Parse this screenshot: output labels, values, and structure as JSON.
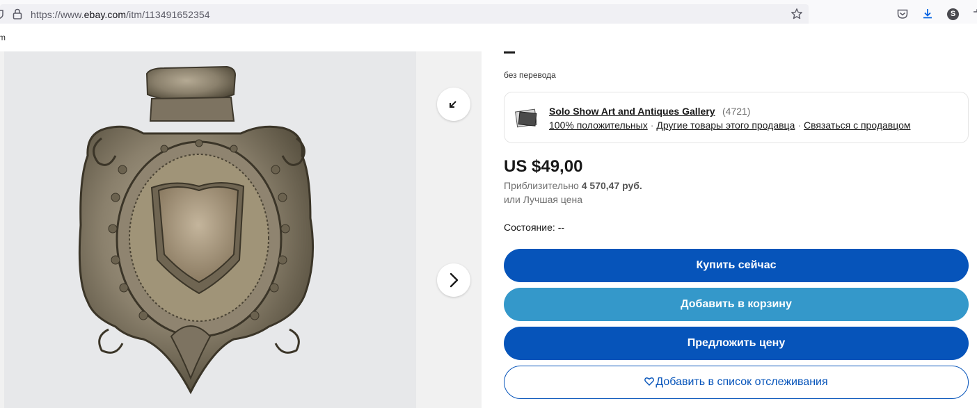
{
  "browser": {
    "url_prefix": "https://www.",
    "url_host": "ebay.com",
    "url_path": "/itm/113491652354",
    "account_initial": "S"
  },
  "subbar": {
    "text": "m"
  },
  "listing": {
    "translation_note": "без перевода",
    "seller": {
      "name": "Solo Show Art and Antiques Gallery",
      "feedback_count": "(4721)",
      "positive": "100% положительных",
      "other_items": "Другие товары этого продавца",
      "contact": "Связаться с продавцом",
      "separator": "·"
    },
    "price": "US $49,00",
    "approx_label": "Приблизительно",
    "approx_value": "4 570,47 руб.",
    "best_offer": "или Лучшая цена",
    "condition_label": "Состояние:",
    "condition_value": "--",
    "buttons": {
      "buy_now": "Купить сейчас",
      "add_to_cart": "Добавить в корзину",
      "make_offer": "Предложить цену",
      "watch": "Добавить в список отслеживания"
    }
  },
  "colors": {
    "primary_blue": "#0654ba",
    "secondary_blue": "#3498ca"
  },
  "icons": [
    "lock-icon",
    "star-icon",
    "pocket-icon",
    "download-icon",
    "collapse-icon",
    "chevron-right-icon",
    "heart-icon"
  ]
}
